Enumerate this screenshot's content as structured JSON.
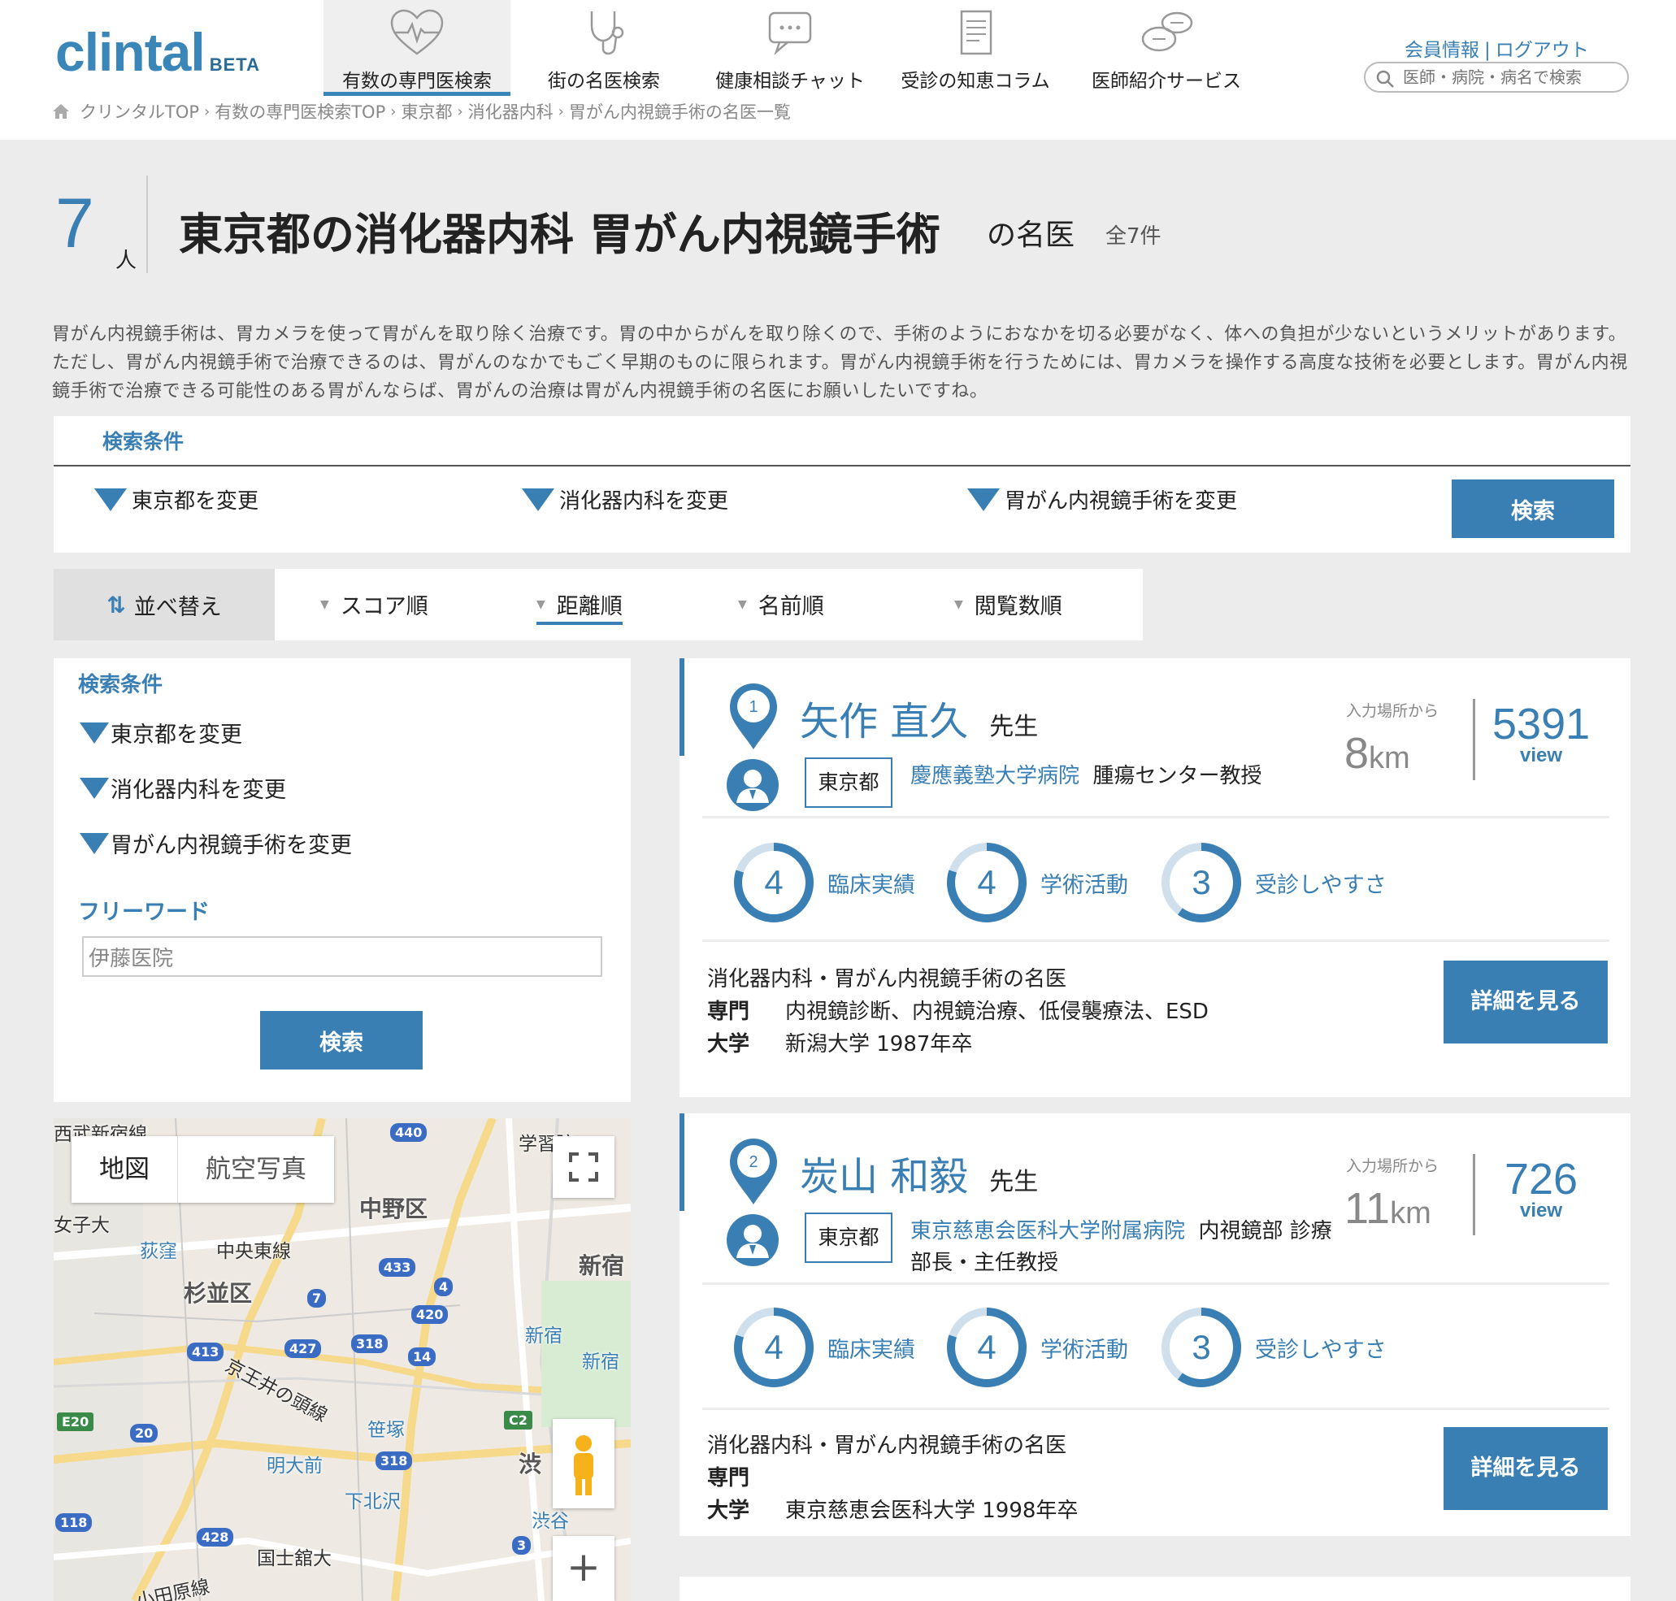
{
  "header": {
    "logo_text": "clintal",
    "logo_badge": "BETA",
    "nav": [
      {
        "label": "有数の専門医検索",
        "icon": "heart-pulse-icon",
        "active": true
      },
      {
        "label": "街の名医検索",
        "icon": "stethoscope-icon",
        "active": false
      },
      {
        "label": "健康相談チャット",
        "icon": "chat-bubble-icon",
        "active": false
      },
      {
        "label": "受診の知恵コラム",
        "icon": "document-icon",
        "active": false
      },
      {
        "label": "医師紹介サービス",
        "icon": "conversation-icon",
        "active": false
      }
    ],
    "member_info": "会員情報",
    "link_sep": "|",
    "logout": "ログアウト",
    "search_placeholder": "医師・病院・病名で検索"
  },
  "breadcrumb": [
    "クリンタルTOP",
    "有数の専門医検索TOP",
    "東京都",
    "消化器内科",
    "胃がん内視鏡手術の名医一覧"
  ],
  "breadcrumb_sep": "›",
  "title": {
    "count": "7",
    "count_unit": "人",
    "main": "東京都の消化器内科 胃がん内視鏡手術",
    "suffix": "の名医",
    "total": "全7件"
  },
  "intro": "胃がん内視鏡手術は、胃カメラを使って胃がんを取り除く治療です。胃の中からがんを取り除くので、手術のようにおなかを切る必要がなく、体への負担が少ないというメリットがあります。ただし、胃がん内視鏡手術で治療できるのは、胃がんのなかでもごく早期のものに限られます。胃がん内視鏡手術を行うためには、胃カメラを操作する高度な技術を必要とします。胃がん内視鏡手術で治療できる可能性のある胃がんならば、胃がんの治療は胃がん内視鏡手術の名医にお願いしたいですね。",
  "filter": {
    "heading": "検索条件",
    "options": [
      "東京都を変更",
      "消化器内科を変更",
      "胃がん内視鏡手術を変更"
    ],
    "search_button": "検索"
  },
  "sort": {
    "label": "並べ替え",
    "arrows": "⇅",
    "options": [
      {
        "label": "スコア順",
        "active": false
      },
      {
        "label": "距離順",
        "active": true
      },
      {
        "label": "名前順",
        "active": false
      },
      {
        "label": "閲覧数順",
        "active": false
      }
    ]
  },
  "sidebar": {
    "heading": "検索条件",
    "options": [
      "東京都を変更",
      "消化器内科を変更",
      "胃がん内視鏡手術を変更"
    ],
    "freeword_heading": "フリーワード",
    "freeword_value": "伊藤医院",
    "search_button": "検索"
  },
  "map": {
    "type_map": "地図",
    "type_satellite": "航空写真",
    "zoom_in": "+",
    "labels": [
      "中野区",
      "杉並区",
      "新宿",
      "渋",
      "京王井の頭線",
      "中央東線",
      "西武新宿線",
      "女子大",
      "学習院",
      "荻窪",
      "新宿",
      "新宿",
      "笹塚",
      "明大前",
      "下北沢",
      "渋谷",
      "国士舘大",
      "小田原線"
    ],
    "shields": [
      "440",
      "433",
      "4",
      "7",
      "420",
      "318",
      "14",
      "413",
      "427",
      "20",
      "E20",
      "318",
      "C2",
      "118",
      "428",
      "3"
    ]
  },
  "doctors": [
    {
      "rank": "1",
      "name": "矢作 直久",
      "honorific": "先生",
      "prefecture": "東京都",
      "hospital": "慶應義塾大学病院",
      "position": "腫瘍センター教授",
      "distance_label": "入力場所から",
      "distance_value": "8",
      "distance_unit": "km",
      "views": "5391",
      "views_label": "view",
      "scores": [
        {
          "label": "臨床実績",
          "value": 4
        },
        {
          "label": "学術活動",
          "value": 4
        },
        {
          "label": "受診しやすさ",
          "value": 3
        }
      ],
      "score_max": 5,
      "specialty_title": "消化器内科・胃がん内視鏡手術の名医",
      "specialty_label": "専門",
      "specialty": "内視鏡診断、内視鏡治療、低侵襲療法、ESD",
      "university_label": "大学",
      "university": "新潟大学 1987年卒",
      "detail_button": "詳細を見る"
    },
    {
      "rank": "2",
      "name": "炭山 和毅",
      "honorific": "先生",
      "prefecture": "東京都",
      "hospital": "東京慈恵会医科大学附属病院",
      "position": "内視鏡部 診療部長・主任教授",
      "distance_label": "入力場所から",
      "distance_value": "11",
      "distance_unit": "km",
      "views": "726",
      "views_label": "view",
      "scores": [
        {
          "label": "臨床実績",
          "value": 4
        },
        {
          "label": "学術活動",
          "value": 4
        },
        {
          "label": "受診しやすさ",
          "value": 3
        }
      ],
      "score_max": 5,
      "specialty_title": "消化器内科・胃がん内視鏡手術の名医",
      "specialty_label": "専門",
      "specialty": "",
      "university_label": "大学",
      "university": "東京慈恵会医科大学 1998年卒",
      "detail_button": "詳細を見る"
    }
  ],
  "colors": {
    "accent": "#3a7fb4",
    "background": "#ececec",
    "ring_track": "#cfe0ec"
  }
}
